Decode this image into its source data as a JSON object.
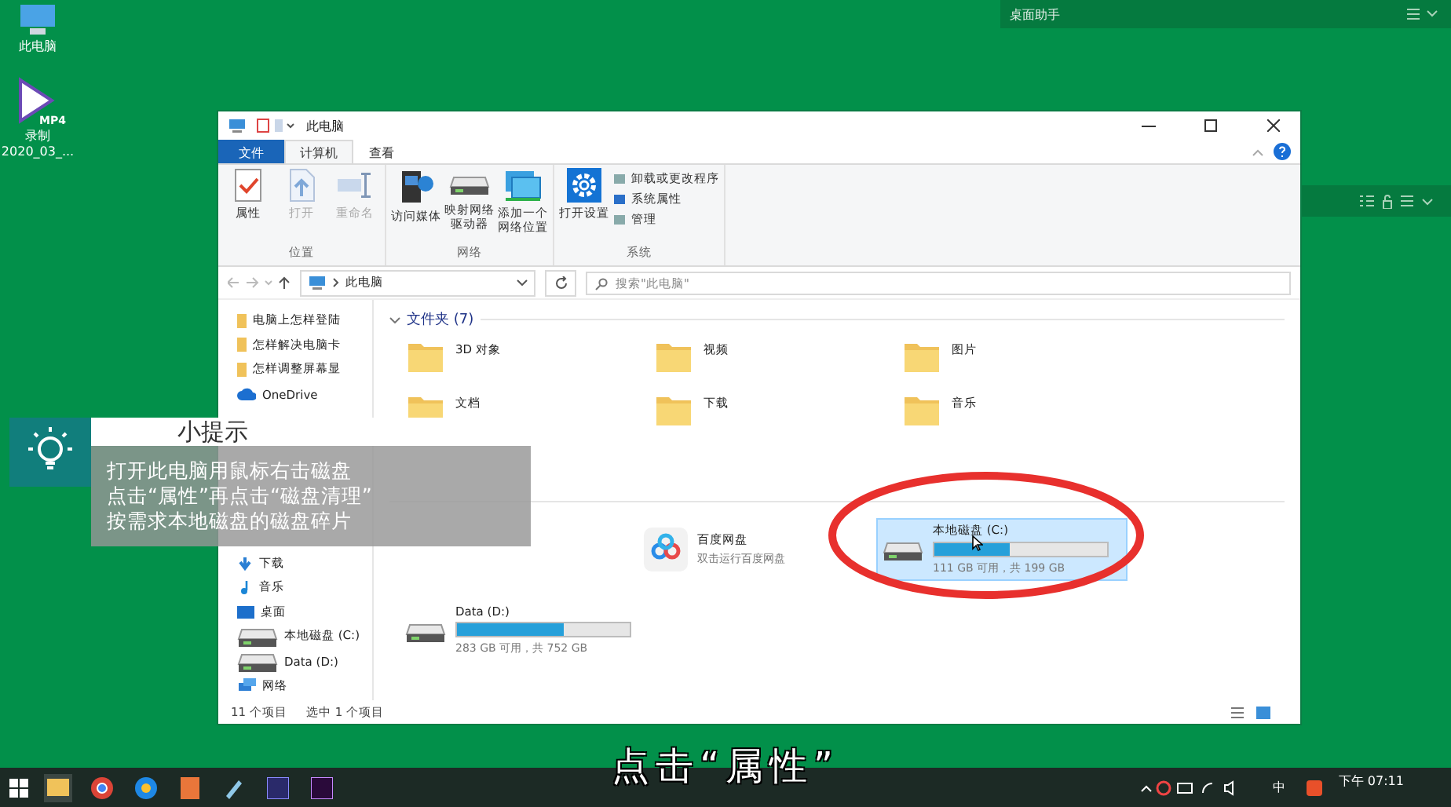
{
  "desktop": {
    "icons": [
      {
        "label": "此电脑",
        "kind": "pc"
      },
      {
        "label": "录制\n2020_03_...",
        "badge": "MP4",
        "kind": "video"
      }
    ]
  },
  "assistant_panel": {
    "title": "桌面助手"
  },
  "window": {
    "title": "此电脑",
    "tabs": [
      {
        "label": "文件",
        "kind": "file",
        "selected": false
      },
      {
        "label": "计算机",
        "kind": "tab",
        "selected": true
      },
      {
        "label": "查看",
        "kind": "tab",
        "selected": false
      }
    ],
    "ribbon": {
      "groups": [
        {
          "label": "位置",
          "buttons": [
            {
              "label": "属性",
              "kind": "properties",
              "disabled": false
            },
            {
              "label": "打开",
              "kind": "open",
              "disabled": true
            },
            {
              "label": "重命名",
              "kind": "rename",
              "disabled": true
            }
          ]
        },
        {
          "label": "网络",
          "buttons": [
            {
              "label": "访问媒体",
              "kind": "media",
              "disabled": false
            },
            {
              "label": "映射网络驱动器",
              "kind": "mapdrive",
              "disabled": false
            },
            {
              "label": "添加一个网络位置",
              "kind": "location",
              "disabled": false
            }
          ]
        },
        {
          "label": "系统",
          "buttons": [
            {
              "label": "打开设置",
              "kind": "settings",
              "disabled": false
            }
          ],
          "small_items": [
            "卸载或更改程序",
            "系统属性",
            "管理"
          ]
        }
      ]
    },
    "address": "此电脑",
    "search": {
      "placeholder": "搜索\"此电脑\""
    },
    "nav_top": [
      {
        "label": "电脑上怎样登陆",
        "kind": "folder",
        "selected": false
      },
      {
        "label": "怎样解决电脑卡",
        "kind": "folder",
        "selected": false
      },
      {
        "label": "怎样调整屏幕显",
        "kind": "folder",
        "selected": false
      },
      {
        "label": "OneDrive",
        "kind": "cloud",
        "selected": false
      }
    ],
    "nav_bottom": [
      {
        "label": "下载",
        "kind": "download",
        "selected": false
      },
      {
        "label": "音乐",
        "kind": "music",
        "selected": false
      },
      {
        "label": "桌面",
        "kind": "desktop",
        "selected": false
      },
      {
        "label": "本地磁盘 (C:)",
        "kind": "drive",
        "selected": false
      },
      {
        "label": "Data (D:)",
        "kind": "drive",
        "selected": false
      },
      {
        "label": "网络",
        "kind": "network",
        "selected": false
      }
    ],
    "folders_header": "文件夹 (7)",
    "folders": [
      {
        "label": "3D 对象"
      },
      {
        "label": "视频"
      },
      {
        "label": "图片"
      },
      {
        "label": "文档"
      },
      {
        "label": "下载"
      },
      {
        "label": "音乐"
      }
    ],
    "devices": [
      {
        "kind": "app",
        "label": "百度网盘",
        "sub": "双击运行百度网盘",
        "selected": false
      },
      {
        "kind": "drive",
        "label": "本地磁盘 (C:)",
        "level": 0.44,
        "sub": "111 GB 可用，共 199 GB",
        "selected": true
      },
      {
        "kind": "drive",
        "label": "Data (D:)",
        "level": 0.62,
        "sub": "283 GB 可用，共 752 GB",
        "selected": false
      }
    ],
    "status": [
      "11 个项目",
      "选中 1 个项目"
    ]
  },
  "tip": {
    "title": "小提示",
    "lines": [
      "打开此电脑用鼠标右击磁盘",
      "点击“属性”再点击“磁盘清理”",
      "按需求本地磁盘的磁盘碎片"
    ]
  },
  "subtitle": "点击“属性”",
  "taskbar": {
    "tray": [
      "中"
    ],
    "time": "下午 07:11"
  }
}
